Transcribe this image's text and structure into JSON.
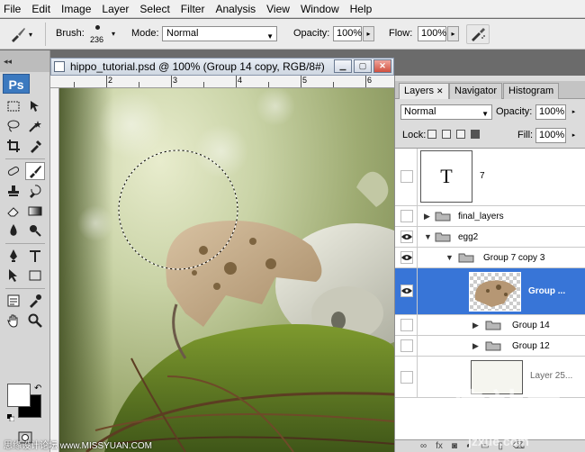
{
  "menu": [
    "File",
    "Edit",
    "Image",
    "Layer",
    "Select",
    "Filter",
    "Analysis",
    "View",
    "Window",
    "Help"
  ],
  "options": {
    "brush_label": "Brush:",
    "brush_size": "236",
    "mode_label": "Mode:",
    "mode_value": "Normal",
    "opacity_label": "Opacity:",
    "opacity_value": "100%",
    "flow_label": "Flow:",
    "flow_value": "100%"
  },
  "toolbox": {
    "app_logo": "Ps",
    "active_tool": "brush-tool",
    "foreground_color": "#ffffff",
    "background_color": "#000000"
  },
  "document": {
    "title": "hippo_tutorial.psd @ 100% (Group 14 copy, RGB/8#)",
    "window_buttons": [
      "minimize",
      "maximize",
      "close"
    ],
    "ruler_labels": [
      "2",
      "3",
      "4",
      "5",
      "6"
    ]
  },
  "layers_panel": {
    "tabs": [
      {
        "label": "Layers",
        "active": true
      },
      {
        "label": "Navigator",
        "active": false
      },
      {
        "label": "Histogram",
        "active": false
      }
    ],
    "blend_mode": "Normal",
    "opacity_label": "Opacity:",
    "opacity_value": "100%",
    "lock_label": "Lock:",
    "fill_label": "Fill:",
    "fill_value": "100%",
    "layers": [
      {
        "name": "7",
        "type": "text",
        "visible": false,
        "thumb": "T"
      },
      {
        "name": "final_layers",
        "type": "group",
        "visible": false,
        "expanded": false
      },
      {
        "name": "egg2",
        "type": "group",
        "visible": true,
        "expanded": true
      },
      {
        "name": "Group 7 copy 3",
        "type": "group",
        "visible": true,
        "expanded": true
      },
      {
        "name": "Group ...",
        "type": "group-thumb",
        "visible": true,
        "selected": true
      },
      {
        "name": "Group 14",
        "type": "group",
        "visible": false,
        "expanded": false
      },
      {
        "name": "Group 12",
        "type": "group",
        "visible": false,
        "expanded": false
      },
      {
        "name": "Layer 25...",
        "type": "layer",
        "visible": false
      }
    ]
  },
  "watermarks": {
    "left": "思缘设计论坛 www.MISSYUAN.COM",
    "right": "建站学",
    "url": "jzxue.com"
  }
}
